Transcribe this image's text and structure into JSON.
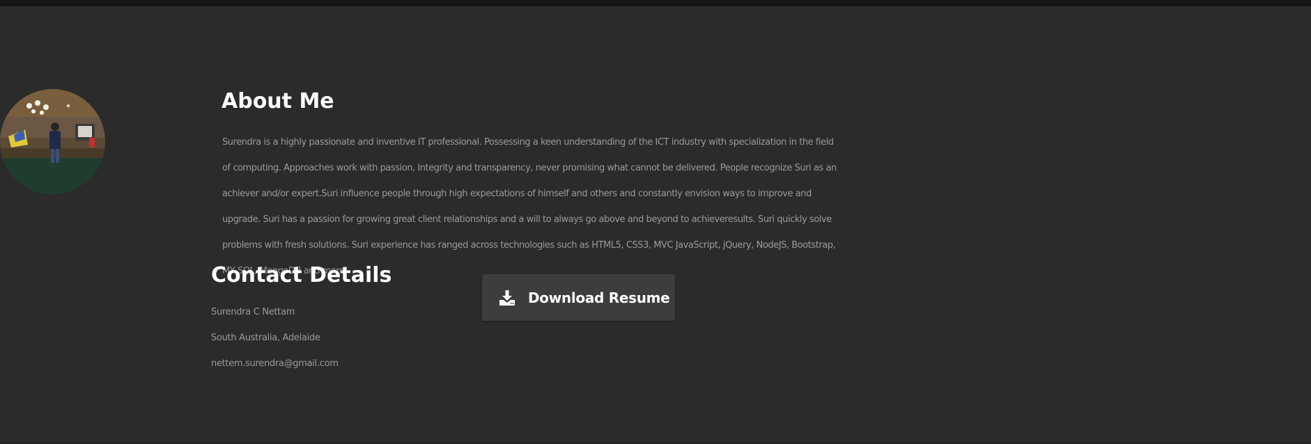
{
  "about": {
    "title": "About Me",
    "text": "Surendra is a highly passionate and inventive IT professional. Possessing a keen understanding of the ICT industry with specialization in the field of computing. Approaches work with passion, Integrity and transparency, never promising what cannot be delivered. People recognize Suri as an achiever and/or expert.Suri influence people through high expectations of himself and others and constantly envision ways to improve and upgrade. Suri has a passion for growing great client relationships and a will to always go above and beyond to achieveresults. Suri quickly solve problems with fresh solutions. Suri experience has ranged across technologies such as HTML5, CSS3, MVC JavaScript, jQuery, NodeJS, Bootstrap, MY SQL, MongoDB and more."
  },
  "contact": {
    "title": "Contact Details",
    "name": "Surendra C Nettam",
    "location": "South Australia, Adelaide",
    "email": "nettem.surendra@gmail.com"
  },
  "resume_button": {
    "label": "Download Resume",
    "icon": "download-icon"
  },
  "colors": {
    "background": "#2b2b2b",
    "heading": "#ffffff",
    "body_text": "#9a9a9a",
    "button_bg": "#3d3d3d",
    "top_bar": "#161616"
  }
}
